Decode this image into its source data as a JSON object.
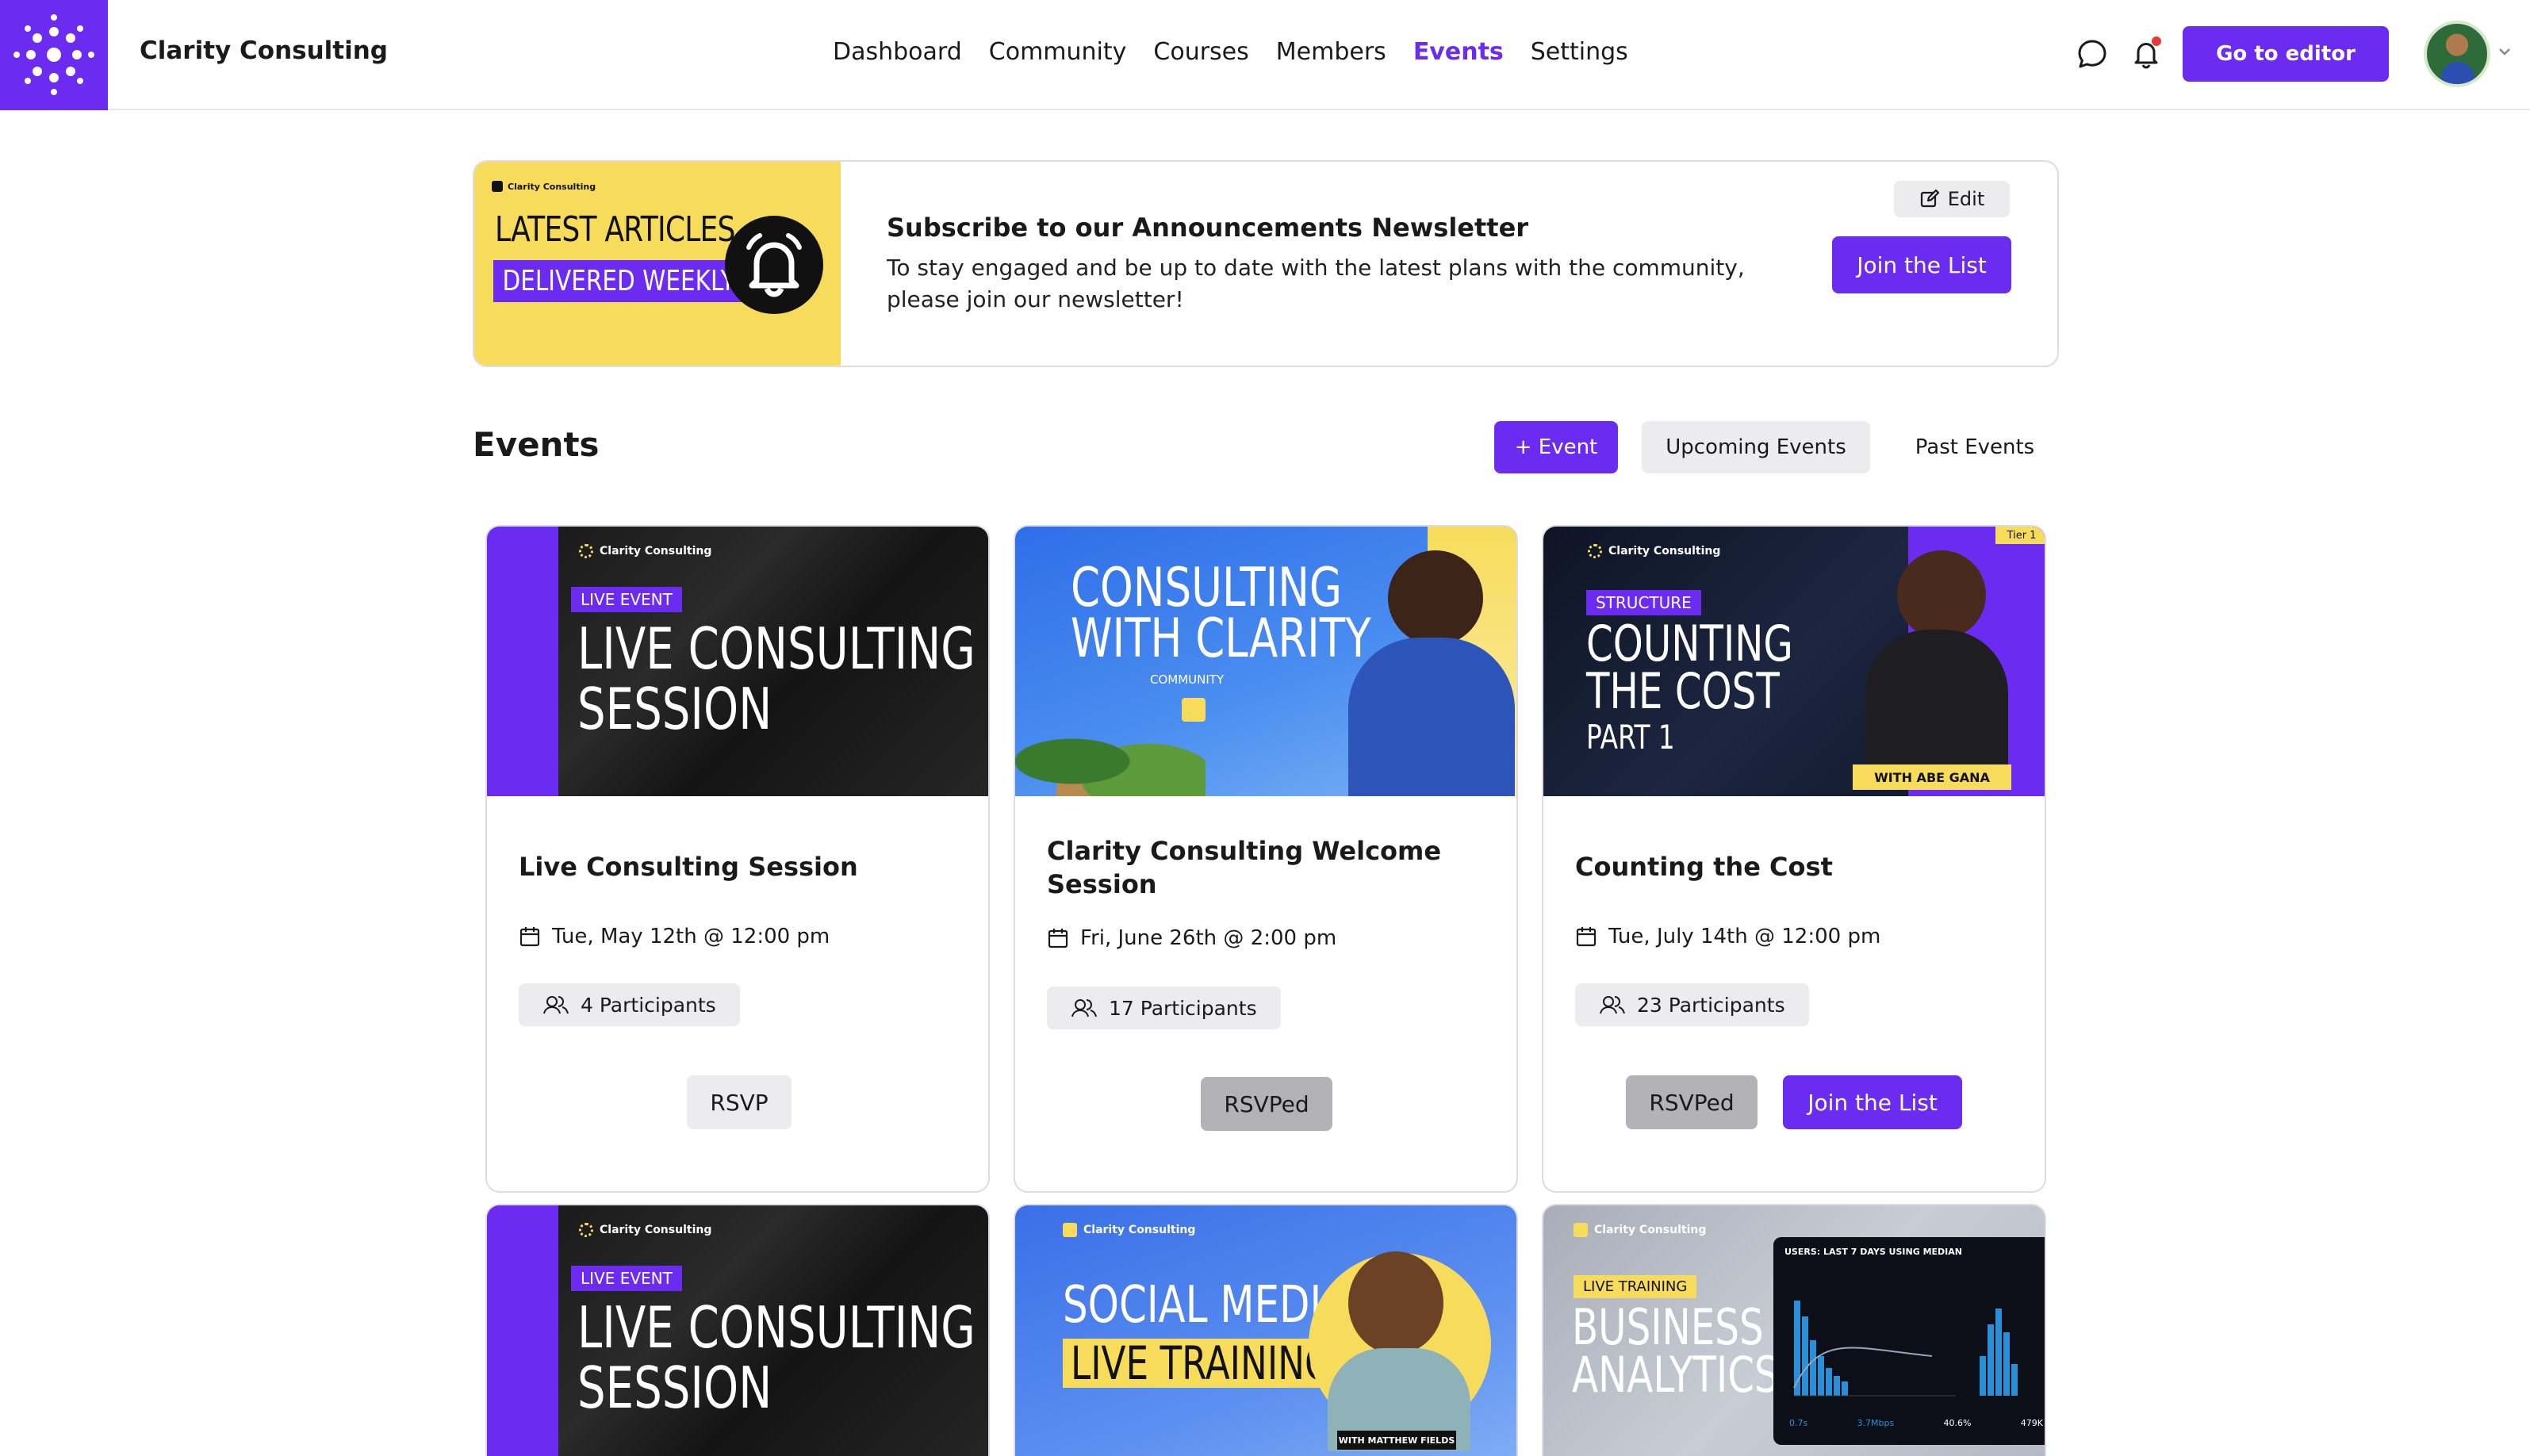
{
  "header": {
    "brand": "Clarity Consulting",
    "nav": [
      "Dashboard",
      "Community",
      "Courses",
      "Members",
      "Events",
      "Settings"
    ],
    "active_nav": "Events",
    "editor_button": "Go to editor",
    "accent": "#6c2bf0",
    "icons": [
      "chat-icon",
      "bell-icon",
      "avatar",
      "chevron-down-icon"
    ]
  },
  "banner": {
    "image": {
      "brand": "Clarity Consulting",
      "line1": "LATEST ARTICLES",
      "line2": "DELIVERED WEEKLY"
    },
    "title": "Subscribe to our Announcements Newsletter",
    "description": "To stay engaged and be up to date with the latest plans with the community, please join our newsletter!",
    "edit_label": "Edit",
    "join_label": "Join the List"
  },
  "events": {
    "heading": "Events",
    "add_button": "+ Event",
    "upcoming_button": "Upcoming Events",
    "past_button": "Past Events",
    "cards": [
      {
        "image": {
          "brand": "Clarity Consulting",
          "tag": "LIVE EVENT",
          "line1": "LIVE CONSULTING",
          "line2": "SESSION"
        },
        "title": "Live Consulting Session",
        "date": "Tue, May 12th @ 12:00 pm",
        "participants": "4 Participants",
        "rsvp": "RSVP"
      },
      {
        "image": {
          "line1": "CONSULTING",
          "line2": "WITH CLARITY",
          "sub": "COMMUNITY"
        },
        "title": "Clarity Consulting Welcome Session",
        "date": "Fri, June 26th @ 2:00 pm",
        "participants": "17 Participants",
        "rsvp": "RSVPed"
      },
      {
        "image": {
          "brand": "Clarity Consulting",
          "tier": "Tier 1",
          "tag": "STRUCTURE",
          "line1": "COUNTING",
          "line2": "THE COST",
          "line3": "PART 1",
          "caption": "WITH ABE GANA"
        },
        "title": "Counting the Cost",
        "date": "Tue, July 14th @ 12:00 pm",
        "participants": "23 Participants",
        "rsvp": "RSVPed",
        "join": "Join the List"
      },
      {
        "image": {
          "brand": "Clarity Consulting",
          "tag": "LIVE EVENT",
          "line1": "LIVE CONSULTING",
          "line2": "SESSION"
        }
      },
      {
        "image": {
          "brand": "Clarity Consulting",
          "line1": "SOCIAL MEDIA",
          "line2": "LIVE TRAINING",
          "caption": "WITH MATTHEW FIELDS"
        }
      },
      {
        "image": {
          "brand": "Clarity Consulting",
          "tag": "LIVE TRAINING",
          "line1": "BUSINESS",
          "line2": "ANALYTICS",
          "dash_title": "USERS: LAST 7 DAYS USING MEDIAN",
          "stats": [
            "0.7s",
            "3.7Mbps",
            "40.6%",
            "479K"
          ]
        }
      }
    ]
  }
}
